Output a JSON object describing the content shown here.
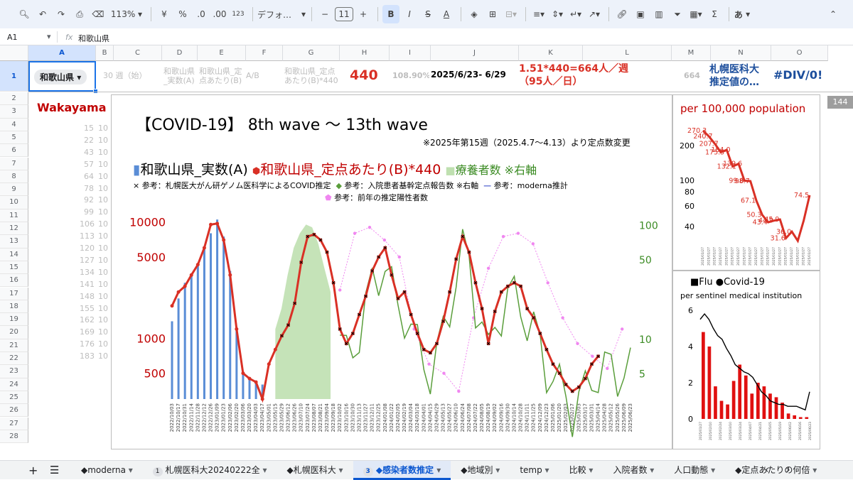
{
  "toolbar": {
    "zoom": "113%",
    "currency": "¥",
    "percent": "%",
    "dec_less": ".0",
    "dec_more": ".00",
    "number_format": "123",
    "font": "デフォ…",
    "font_size": "11",
    "bold": "B",
    "italic": "I",
    "strike": "S",
    "text_color": "A",
    "input_mode": "あ"
  },
  "formula_bar": {
    "cell_ref": "A1",
    "fx": "fx",
    "content": "和歌山県"
  },
  "columns": [
    "A",
    "B",
    "C",
    "D",
    "E",
    "F",
    "G",
    "H",
    "I",
    "J",
    "K",
    "L",
    "M",
    "N",
    "O"
  ],
  "rows": [
    "1",
    "2",
    "3",
    "4",
    "5",
    "6",
    "7",
    "8",
    "9",
    "10",
    "11",
    "12",
    "13",
    "14",
    "15",
    "16",
    "17",
    "18",
    "19",
    "20",
    "21",
    "22",
    "23",
    "24",
    "25",
    "26",
    "27",
    "28"
  ],
  "row1": {
    "a1": "和歌山県",
    "c1": "30 週（始）",
    "d1": "和歌山県\n_実数(A)",
    "e1": "和歌山県_定\n点あたり(B)",
    "f1": "A/B",
    "g1": "和歌山県_定点\nあたり(B)*440",
    "h1": "440",
    "i1": "108.90%",
    "j1": "2025/6/23- 6/29",
    "k1": "1.51*440=664人／週\n（95人／日）",
    "m1": "664",
    "n1": "札幌医科大\n推定値の…",
    "o1": "#DIV/0!"
  },
  "left_cells": {
    "a2": "Wakayama",
    "bvals": [
      "15",
      "10",
      "22",
      "10",
      "43",
      "10",
      "57",
      "10",
      "64",
      "10",
      "78",
      "10",
      "92",
      "10",
      "99",
      "10",
      "106",
      "10",
      "113",
      "10",
      "120",
      "10",
      "127",
      "10",
      "134",
      "10",
      "141",
      "10",
      "148",
      "10",
      "155",
      "10",
      "162",
      "10",
      "169",
      "10",
      "176",
      "10",
      "183",
      "10"
    ]
  },
  "right_cell": "144",
  "main_chart": {
    "title": "【COVID-19】 8th wave 〜 13th wave",
    "note": "※2025年第15週（2025.4.7〜4.13）より定点数変更",
    "legend": {
      "s1": "和歌山県_実数(A)",
      "s2": "和歌山県_定点あたり(B)*440",
      "s3": "療養者数 ※右軸",
      "s4": "参考：札幌医大がん研ゲノム医科学によるCOVID推定",
      "s5": "参考：入院患者基幹定点報告数 ※右軸",
      "s6": "参考：moderna推計",
      "s7": "参考：前年の推定陽性者数"
    },
    "left_ticks": [
      "10000",
      "5000",
      "1000",
      "500"
    ],
    "right_ticks": [
      "100",
      "50",
      "10",
      "5"
    ]
  },
  "chart_data": [
    {
      "type": "line",
      "title": "【COVID-19】 8th wave 〜 13th wave",
      "ylabel": "",
      "yscale": "log",
      "left_ticks": [
        10000,
        5000,
        1000,
        500
      ],
      "right_ticks": [
        100,
        50,
        10,
        5
      ],
      "x": [
        "2022/10/03",
        "2022/10/17",
        "2022/10/31",
        "2022/11/14",
        "2022/11/28",
        "2022/12/12",
        "2022/12/26",
        "2023/01/09",
        "2023/01/23",
        "2023/02/06",
        "2023/02/20",
        "2023/03/06",
        "2023/03/20",
        "2023/04/03",
        "2023/04/17",
        "2023/05/01",
        "2023/05/15",
        "2023/05/29",
        "2023/06/12",
        "2023/06/26",
        "2023/07/10",
        "2023/07/24",
        "2023/08/07",
        "2023/08/21",
        "2023/09/04",
        "2023/09/18",
        "2023/10/02",
        "2023/10/16",
        "2023/10/30",
        "2023/11/13",
        "2023/11/27",
        "2023/12/11",
        "2023/12/25",
        "2024/01/08",
        "2024/01/22",
        "2024/02/05",
        "2024/02/19",
        "2024/03/04",
        "2024/03/18",
        "2024/04/01",
        "2024/04/15",
        "2024/04/29",
        "2024/05/13",
        "2024/05/27",
        "2024/06/10",
        "2024/06/24",
        "2024/07/08",
        "2024/07/22",
        "2024/08/05",
        "2024/08/19",
        "2024/09/02",
        "2024/09/16",
        "2024/09/30",
        "2024/10/14",
        "2024/10/28",
        "2024/11/11",
        "2024/11/25",
        "2024/12/09",
        "2024/12/23",
        "2025/01/06",
        "2025/01/20",
        "2025/02/03",
        "2025/02/17",
        "2025/03/03",
        "2025/03/17",
        "2025/03/31",
        "2025/04/14",
        "2025/04/28",
        "2025/05/12",
        "2025/05/26",
        "2025/06/09",
        "2025/06/23"
      ],
      "series": [
        {
          "name": "和歌山県_定点あたり(B)*440",
          "values": [
            1900,
            2500,
            2800,
            3500,
            4300,
            6000,
            9500,
            9700,
            7000,
            3500,
            1200,
            500,
            450,
            420,
            300,
            600,
            800,
            1050,
            1300,
            2000,
            4500,
            7500,
            7800,
            7000,
            5500,
            3000,
            1200,
            900,
            1100,
            1600,
            2300,
            3800,
            5000,
            6000,
            3500,
            2200,
            2500,
            1600,
            1100,
            800,
            750,
            900,
            1400,
            2500,
            4800,
            7500,
            5500,
            3000,
            1800,
            900,
            1700,
            2500,
            2800,
            3000,
            2800,
            1800,
            1500,
            1100,
            800,
            600,
            500,
            400,
            350,
            380,
            450,
            600,
            700
          ],
          "color": "#d93025"
        },
        {
          "name": "和歌山県_実数(A)",
          "values": [
            1400,
            2200,
            3000,
            3500,
            4400,
            6000,
            8000,
            10500,
            7500,
            3800,
            1200,
            500,
            450,
            420,
            400
          ],
          "color": "#5a8dd6"
        },
        {
          "name": "療養者数 ※右軸",
          "values": [
            1200,
            1800,
            3500,
            6000,
            8000,
            9500,
            9000,
            6500,
            4000,
            2500
          ],
          "color": "#a8cc9a"
        },
        {
          "name": "参考：前年の推定陽性者数",
          "values": [
            2600,
            8000,
            9000,
            7000,
            5000,
            1200,
            600,
            500,
            350,
            1500,
            4000,
            7500,
            8000,
            6500,
            3000,
            1500,
            900,
            700,
            550,
            1200
          ],
          "color": "#f087f0"
        }
      ]
    },
    {
      "type": "line",
      "title": "per 100,000 population",
      "ylabel": "",
      "yscale": "log",
      "y_ticks": [
        200,
        100,
        80,
        60,
        40
      ],
      "labels": [
        "270.3",
        "240.7",
        "207.7",
        "175.5",
        "184.0",
        "132.1",
        "139.6",
        "99.6",
        "98.7",
        "67.1",
        "50.3",
        "43.4",
        "44.9",
        "45.9",
        "31.6",
        "36.0",
        "74.5"
      ],
      "values": [
        270.3,
        240.7,
        207.7,
        175.5,
        184.0,
        132.1,
        139.6,
        99.6,
        98.7,
        67.1,
        50.3,
        43.4,
        44.9,
        45.9,
        31.6,
        36.0,
        30.0,
        45.0,
        74.5
      ],
      "color": "#d93025"
    },
    {
      "type": "bar",
      "title": "■Flu ●Covid-19",
      "subtitle": "per sentinel medical institution",
      "ylim": [
        0,
        6
      ],
      "y_ticks": [
        0,
        2,
        4,
        6
      ],
      "x": [
        "2025/01/27",
        "2025/02/10",
        "2025/02/24",
        "2025/03/10",
        "2025/03/24",
        "2025/04/07",
        "2025/04/21",
        "2025/05/05",
        "2025/05/19",
        "2025/06/02",
        "2025/06/16",
        "2025/06/23"
      ],
      "series": [
        {
          "name": "Flu",
          "values": [
            4.8,
            4.0,
            1.8,
            1.0,
            0.8,
            2.1,
            3.0,
            2.4,
            1.4,
            2.0,
            1.8,
            1.4,
            1.2,
            0.9,
            0.3,
            0.2,
            0.1,
            0.1
          ],
          "color": "#e01010"
        },
        {
          "name": "Covid-19",
          "values": [
            5.5,
            5.8,
            5.5,
            5.0,
            4.6,
            4.4,
            3.9,
            3.5,
            3.0,
            2.8,
            2.6,
            2.5,
            2.3,
            1.9,
            1.5,
            1.3,
            1.0,
            0.9,
            0.8,
            0.8,
            0.7,
            0.7,
            0.7,
            0.6,
            0.5,
            1.5
          ],
          "color": "#000000"
        }
      ]
    }
  ],
  "tabs": [
    {
      "label": "◆moderna"
    },
    {
      "badge": "1",
      "label": "札幌医科大20240222全"
    },
    {
      "label": "◆札幌医科大"
    },
    {
      "badge": "3",
      "label": "◆感染者数推定",
      "active": true
    },
    {
      "label": "◆地域別"
    },
    {
      "label": "temp"
    },
    {
      "label": "比較"
    },
    {
      "label": "入院者数"
    },
    {
      "label": "人口動態"
    },
    {
      "label": "◆定点あたりの何倍"
    }
  ]
}
